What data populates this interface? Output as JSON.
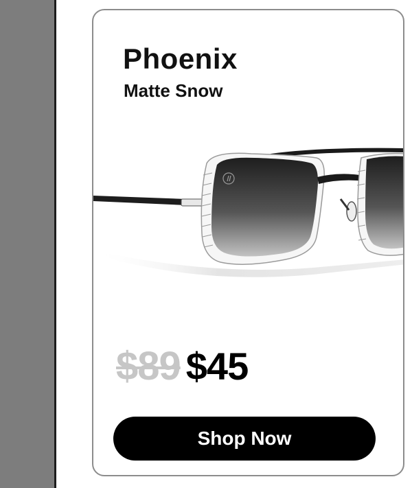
{
  "product": {
    "name": "Phoenix",
    "variant": "Matte Snow",
    "original_price": "$89",
    "sale_price": "$45",
    "image_icon": "sunglasses-photo"
  },
  "actions": {
    "shop_label": "Shop Now"
  },
  "colors": {
    "side_panel": "#7d7d7d",
    "card_border": "#8c8c8c",
    "button": "#000000",
    "old_price": "#c6c6c6"
  }
}
